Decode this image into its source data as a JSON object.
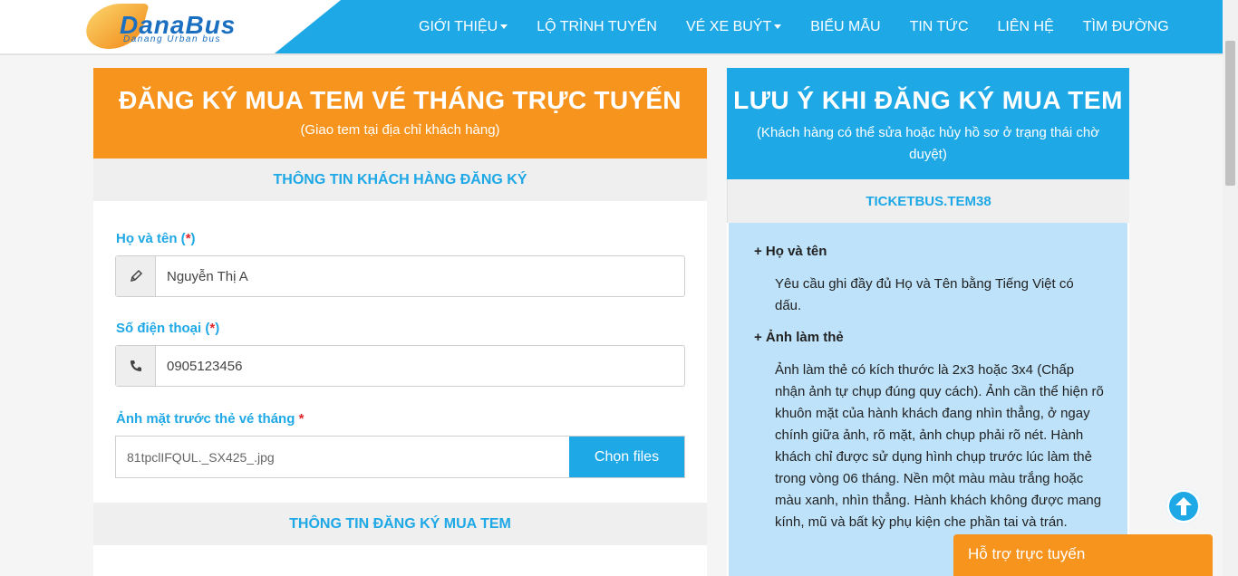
{
  "brand": {
    "name": "DanaBus",
    "tagline": "Danang Urban bus"
  },
  "nav": [
    {
      "label": "GIỚI THIỆU",
      "dropdown": true
    },
    {
      "label": "LỘ TRÌNH TUYẾN",
      "dropdown": false
    },
    {
      "label": "VÉ XE BUÝT",
      "dropdown": true
    },
    {
      "label": "BIỂU MẪU",
      "dropdown": false
    },
    {
      "label": "TIN TỨC",
      "dropdown": false
    },
    {
      "label": "LIÊN HỆ",
      "dropdown": false
    },
    {
      "label": "TÌM ĐƯỜNG",
      "dropdown": false
    }
  ],
  "left": {
    "title": "ĐĂNG KÝ MUA TEM VÉ THÁNG TRỰC TUYẾN",
    "subtitle": "(Giao tem tại địa chỉ khách hàng)",
    "section1": "THÔNG TIN KHÁCH HÀNG ĐĂNG KÝ",
    "name_label": "Họ và tên (",
    "name_label_end": ")",
    "name_value": "Nguyễn Thị A",
    "phone_label": "Số điện thoại (",
    "phone_label_end": ")",
    "phone_value": "0905123456",
    "photo_label": "Ảnh mặt trước thẻ vé tháng ",
    "required_mark": "*",
    "file_name": "81tpclIFQUL._SX425_.jpg",
    "file_button": "Chọn files",
    "section2": "THÔNG TIN ĐĂNG KÝ MUA TEM"
  },
  "right": {
    "title": "LƯU Ý KHI ĐĂNG KÝ MUA TEM",
    "subtitle": "(Khách hàng có thể sửa hoặc hủy hồ sơ ở trạng thái chờ duyệt)",
    "bar": "TICKETBUS.TEM38",
    "h1": "+ Họ và tên",
    "p1": "Yêu cầu ghi đầy đủ Họ và Tên bằng Tiếng Việt có dấu.",
    "h2": "+ Ảnh làm thẻ",
    "p2": "Ảnh làm thẻ có kích thước là 2x3 hoặc 3x4 (Chấp nhận ảnh tự chụp đúng quy cách). Ảnh cần thể hiện rõ khuôn mặt của hành khách đang nhìn thẳng, ở ngay chính giữa ảnh, rõ mặt, ảnh chụp phải rõ nét. Hành khách chỉ được sử dụng hình chụp trước lúc làm thẻ trong vòng 06 tháng. Nền một màu màu trắng hoặc màu xanh, nhìn thẳng. Hành khách không được mang kính, mũ và bất kỳ phụ kiện che phần tai và trán."
  },
  "support": "Hỗ trợ trực tuyến",
  "colors": {
    "primary": "#1ea8e6",
    "accent": "#f7941d",
    "info_bg": "#bde2f9"
  }
}
